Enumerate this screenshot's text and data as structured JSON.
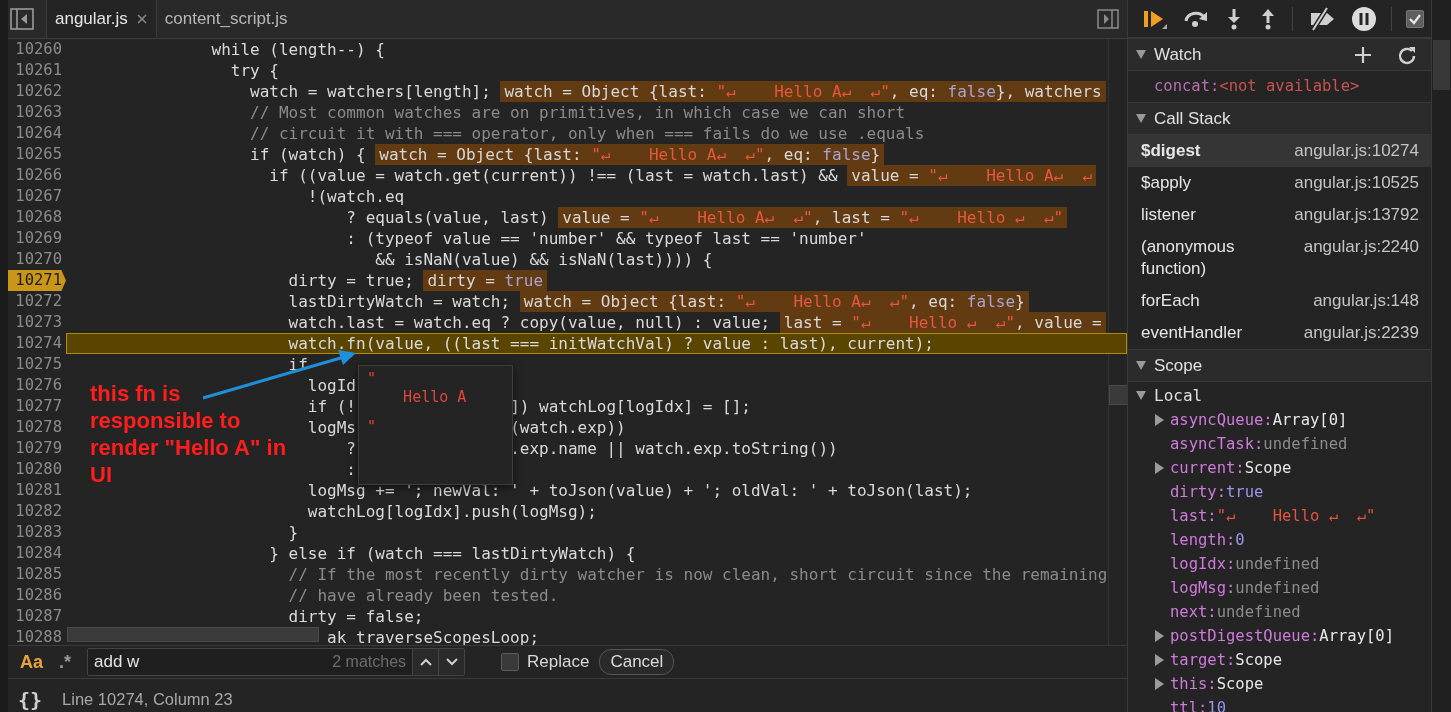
{
  "editor": {
    "tabs": [
      {
        "label": "angular.js",
        "selected": true,
        "closable": true
      },
      {
        "label": "content_script.js",
        "selected": false,
        "closable": false
      }
    ],
    "lines": [
      {
        "number": "10260",
        "code": "               while (length--) {",
        "kind": "code",
        "breakpoint": false,
        "current": false
      },
      {
        "number": "10261",
        "code": "                 try {",
        "kind": "code",
        "breakpoint": false,
        "current": false
      },
      {
        "number": "10262",
        "code": "                   watch = watchers[length];",
        "kind": "code",
        "breakpoint": false,
        "current": false,
        "inline_value": [
          {
            "text": "watch = Object {last: ",
            "kind": "plain"
          },
          {
            "text": "\"↵    Hello A↵  ↵\"",
            "kind": "string"
          },
          {
            "text": ", eq: ",
            "kind": "plain"
          },
          {
            "text": "false",
            "kind": "bool"
          },
          {
            "text": "}, watchers",
            "kind": "plain"
          }
        ]
      },
      {
        "number": "10263",
        "code": "                   // Most common watches are on primitives, in which case we can short",
        "kind": "comment",
        "breakpoint": false,
        "current": false
      },
      {
        "number": "10264",
        "code": "                   // circuit it with === operator, only when === fails do we use .equals",
        "kind": "comment",
        "breakpoint": false,
        "current": false
      },
      {
        "number": "10265",
        "code": "                   if (watch) {",
        "kind": "code",
        "breakpoint": false,
        "current": false,
        "inline_value": [
          {
            "text": "watch = Object {last: ",
            "kind": "plain"
          },
          {
            "text": "\"↵    Hello A↵  ↵\"",
            "kind": "string"
          },
          {
            "text": ", eq: ",
            "kind": "plain"
          },
          {
            "text": "false",
            "kind": "bool"
          },
          {
            "text": "}",
            "kind": "plain"
          }
        ]
      },
      {
        "number": "10266",
        "code": "                     if ((value = watch.get(current)) !== (last = watch.last) &&",
        "kind": "code",
        "breakpoint": false,
        "current": false,
        "inline_value": [
          {
            "text": "value = ",
            "kind": "plain"
          },
          {
            "text": "\"↵    Hello A↵  ↵",
            "kind": "string"
          }
        ]
      },
      {
        "number": "10267",
        "code": "                         !(watch.eq",
        "kind": "code",
        "breakpoint": false,
        "current": false
      },
      {
        "number": "10268",
        "code": "                             ? equals(value, last)",
        "kind": "code",
        "breakpoint": false,
        "current": false,
        "inline_value": [
          {
            "text": "value = ",
            "kind": "plain"
          },
          {
            "text": "\"↵    Hello A↵  ↵\"",
            "kind": "string"
          },
          {
            "text": ", last = ",
            "kind": "plain"
          },
          {
            "text": "\"↵    Hello ↵  ↵\"",
            "kind": "string"
          }
        ]
      },
      {
        "number": "10269",
        "code": "                             : (typeof value == 'number' && typeof last == 'number'",
        "kind": "code",
        "breakpoint": false,
        "current": false
      },
      {
        "number": "10270",
        "code": "                                && isNaN(value) && isNaN(last)))) {",
        "kind": "code",
        "breakpoint": false,
        "current": false
      },
      {
        "number": "10271",
        "code": "                       dirty = true;",
        "kind": "code",
        "breakpoint": true,
        "current": false,
        "inline_value": [
          {
            "text": "dirty = ",
            "kind": "plain"
          },
          {
            "text": "true",
            "kind": "bool"
          }
        ]
      },
      {
        "number": "10272",
        "code": "                       lastDirtyWatch = watch;",
        "kind": "code",
        "breakpoint": false,
        "current": false,
        "inline_value": [
          {
            "text": "watch = Object {last: ",
            "kind": "plain"
          },
          {
            "text": "\"↵    Hello A↵  ↵\"",
            "kind": "string"
          },
          {
            "text": ", eq: ",
            "kind": "plain"
          },
          {
            "text": "false",
            "kind": "bool"
          },
          {
            "text": "}",
            "kind": "plain"
          }
        ]
      },
      {
        "number": "10273",
        "code": "                       watch.last = watch.eq ? copy(value, null) : value;",
        "kind": "code",
        "breakpoint": false,
        "current": false,
        "inline_value": [
          {
            "text": "last = ",
            "kind": "plain"
          },
          {
            "text": "\"↵    Hello ↵  ↵\"",
            "kind": "string"
          },
          {
            "text": ", value =",
            "kind": "plain"
          }
        ]
      },
      {
        "number": "10274",
        "code": "                       watch.fn(value, ((last === initWatchVal) ? value : last), current);",
        "kind": "code",
        "breakpoint": false,
        "current": true
      },
      {
        "number": "10275",
        "code": "                       if",
        "kind": "code",
        "breakpoint": false,
        "current": false
      },
      {
        "number": "10276",
        "code": "                         logId",
        "kind": "code",
        "breakpoint": false,
        "current": false
      },
      {
        "number": "10277",
        "code": "                         if (!",
        "code_after": "]) watchLog[logIdx] = [];",
        "kind": "code",
        "breakpoint": false,
        "current": false
      },
      {
        "number": "10278",
        "code": "                         logMs",
        "code_after": "(watch.exp))",
        "kind": "code",
        "breakpoint": false,
        "current": false
      },
      {
        "number": "10279",
        "code": "                             ?",
        "code_after": ".exp.name || watch.exp.toString())",
        "kind": "code",
        "breakpoint": false,
        "current": false
      },
      {
        "number": "10280",
        "code": "                             :",
        "kind": "code",
        "breakpoint": false,
        "current": false
      },
      {
        "number": "10281",
        "code": "                         logMsg += '; newVal: ' + toJson(value) + '; oldVal: ' + toJson(last);",
        "kind": "code",
        "breakpoint": false,
        "current": false
      },
      {
        "number": "10282",
        "code": "                         watchLog[logIdx].push(logMsg);",
        "kind": "code",
        "breakpoint": false,
        "current": false
      },
      {
        "number": "10283",
        "code": "                       }",
        "kind": "code",
        "breakpoint": false,
        "current": false
      },
      {
        "number": "10284",
        "code": "                     } else if (watch === lastDirtyWatch) {",
        "kind": "code",
        "breakpoint": false,
        "current": false
      },
      {
        "number": "10285",
        "code": "                       // If the most recently dirty watcher is now clean, short circuit since the remaining",
        "kind": "comment",
        "breakpoint": false,
        "current": false
      },
      {
        "number": "10286",
        "code": "                       // have already been tested.",
        "kind": "comment",
        "breakpoint": false,
        "current": false
      },
      {
        "number": "10287",
        "code": "                       dirty = false;",
        "kind": "code",
        "breakpoint": false,
        "current": false
      },
      {
        "number": "10288",
        "code": "                           ak traverseScopesLoop;",
        "kind": "code",
        "breakpoint": false,
        "current": false
      }
    ],
    "tooltip": {
      "lines": [
        "\"",
        "    Hello A",
        "\""
      ]
    },
    "annotation": {
      "text": "this fn is responsible to render \"Hello A\" in UI"
    },
    "search": {
      "match_case": {
        "label": "Aa",
        "on": true
      },
      "regex": {
        "label": ".*",
        "on": false
      },
      "value": "add w",
      "matches": "2 matches",
      "replace": {
        "label": "Replace",
        "checked": false
      },
      "cancel": "Cancel"
    },
    "status_bar": {
      "pretty_print": "{}",
      "position": "Line 10274, Column 23"
    }
  },
  "debugger": {
    "toolbar": {
      "breakpoints_checkbox": {
        "checked": true
      }
    },
    "watch": {
      "title": "Watch",
      "expanded": true,
      "items": [
        {
          "name": "concat:",
          "value": "<not available>"
        }
      ]
    },
    "call_stack": {
      "title": "Call Stack",
      "expanded": true,
      "frames": [
        {
          "name": "$digest",
          "location": "angular.js:10274",
          "selected": true
        },
        {
          "name": "$apply",
          "location": "angular.js:10525",
          "selected": false
        },
        {
          "name": "listener",
          "location": "angular.js:13792",
          "selected": false
        },
        {
          "name": "(anonymous function)",
          "location": "angular.js:2240",
          "selected": false
        },
        {
          "name": "forEach",
          "location": "angular.js:148",
          "selected": false
        },
        {
          "name": "eventHandler",
          "location": "angular.js:2239",
          "selected": false
        }
      ]
    },
    "scope": {
      "title": "Scope",
      "expanded": true,
      "groups": [
        {
          "title": "Local",
          "expanded": true,
          "children": [
            {
              "name": "asyncQueue:",
              "value": "Array[0]",
              "kind": "object",
              "expandable": true
            },
            {
              "name": "asyncTask:",
              "value": "undefined",
              "kind": "undefined",
              "expandable": false
            },
            {
              "name": "current:",
              "value": "Scope",
              "kind": "object",
              "expandable": true
            },
            {
              "name": "dirty:",
              "value": "true",
              "kind": "literal",
              "expandable": false
            },
            {
              "name": "last:",
              "value": "\"↵    Hello ↵  ↵\"",
              "kind": "string",
              "expandable": false
            },
            {
              "name": "length:",
              "value": "0",
              "kind": "literal",
              "expandable": false
            },
            {
              "name": "logIdx:",
              "value": "undefined",
              "kind": "undefined",
              "expandable": false
            },
            {
              "name": "logMsg:",
              "value": "undefined",
              "kind": "undefined",
              "expandable": false
            },
            {
              "name": "next:",
              "value": "undefined",
              "kind": "undefined",
              "expandable": false
            },
            {
              "name": "postDigestQueue:",
              "value": "Array[0]",
              "kind": "object",
              "expandable": true
            },
            {
              "name": "target:",
              "value": "Scope",
              "kind": "object",
              "expandable": true
            },
            {
              "name": "this:",
              "value": "Scope",
              "kind": "object",
              "expandable": true
            },
            {
              "name": "ttl:",
              "value": "10",
              "kind": "literal",
              "expandable": false
            }
          ]
        }
      ]
    }
  }
}
